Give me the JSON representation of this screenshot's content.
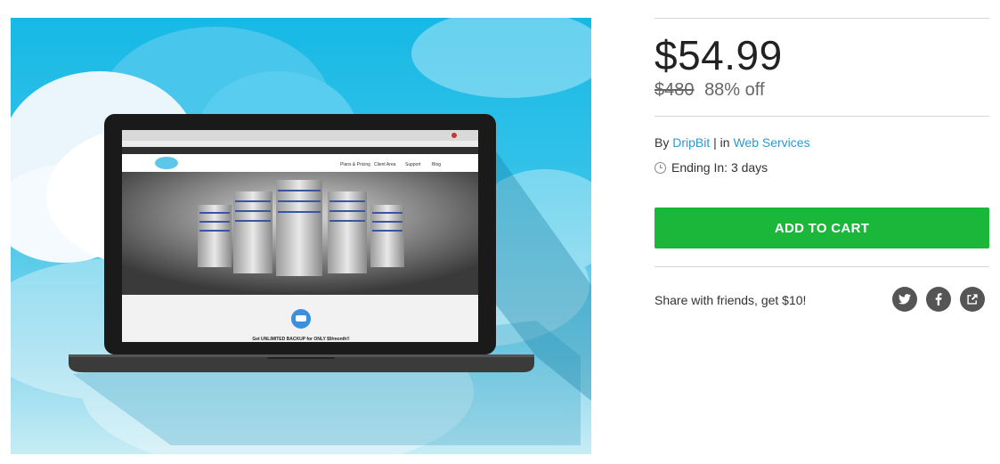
{
  "product": {
    "image_alt": "Laptop showing DripBit website with cloud background",
    "price": "$54.99",
    "original_price": "$480",
    "discount": "88% off",
    "by_label": "By",
    "vendor": "DripBit",
    "separator": "| in",
    "category": "Web Services",
    "ending_label": "Ending In: 3 days"
  },
  "actions": {
    "add_to_cart": "ADD TO CART"
  },
  "share": {
    "text": "Share with friends, get $10!",
    "icons": [
      "twitter-icon",
      "facebook-icon",
      "share-icon"
    ]
  },
  "colors": {
    "accent_green": "#1ab73a",
    "link_blue": "#2a9ad5",
    "icon_gray": "#555555"
  },
  "screen": {
    "banner_text": "Get UNLIMITED BACKUP for ONLY $9/month!!",
    "nav": [
      "Plans & Pricing",
      "Client Area",
      "Support",
      "Blog"
    ],
    "logo": "dripbit"
  }
}
